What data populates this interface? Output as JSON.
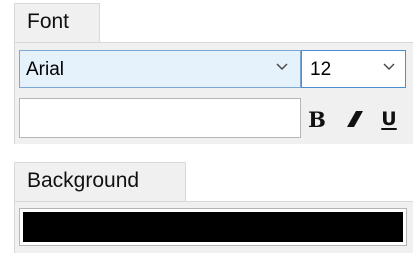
{
  "font_tab": {
    "label": "Font"
  },
  "font_name": {
    "value": "Arial"
  },
  "font_size": {
    "value": "12"
  },
  "text_input": {
    "value": ""
  },
  "format_buttons": {
    "bold": "B",
    "underline": "U"
  },
  "background_tab": {
    "label": "Background"
  },
  "background_color": {
    "value": "#000000"
  },
  "icons": {
    "dropdown": "chevron-down-icon",
    "italic": "italic-icon"
  },
  "colors": {
    "panel": "#f0f0f0",
    "selected_combo": "#e5f1fb",
    "focus_border": "#4c8fd0"
  }
}
